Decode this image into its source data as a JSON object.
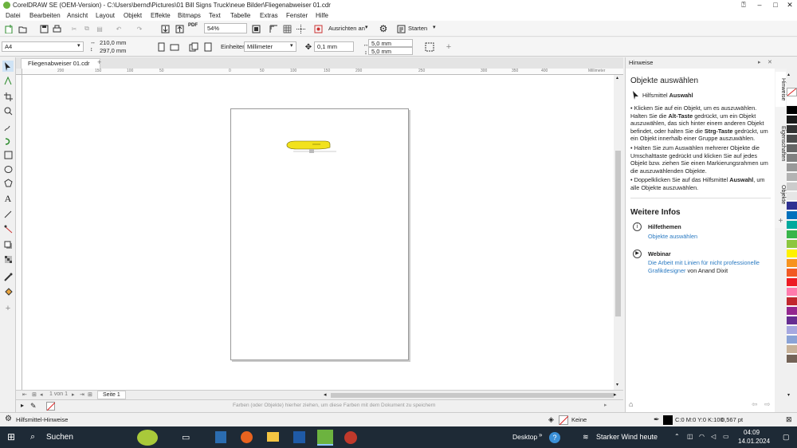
{
  "window": {
    "title": "CorelDRAW SE (OEM-Version) - C:\\Users\\bernd\\Pictures\\01 Bill Signs Truck\\neue Bilder\\Fliegenabweiser 01.cdr",
    "minimize": "–",
    "maximize": "□",
    "close": "✕",
    "help": "?"
  },
  "menu": [
    "Datei",
    "Bearbeiten",
    "Ansicht",
    "Layout",
    "Objekt",
    "Effekte",
    "Bitmaps",
    "Text",
    "Tabelle",
    "Extras",
    "Fenster",
    "Hilfe"
  ],
  "standard_toolbar": {
    "zoom": "54%",
    "snap_label": "Ausrichten an",
    "launch_label": "Starten",
    "pdf_label": "PDF"
  },
  "property_bar": {
    "page_size": "A4",
    "width": "210,0 mm",
    "height": "297,0 mm",
    "units_label": "Einheiten:",
    "units_value": "Millimeter",
    "nudge": "0,1 mm",
    "dup_x": "5,0 mm",
    "dup_y": "5,0 mm"
  },
  "document": {
    "tab_label": "Fliegenabweiser 01.cdr",
    "ruler_h": [
      "200",
      "150",
      "100",
      "50",
      "0",
      "50",
      "100",
      "150",
      "200",
      "250",
      "300",
      "350",
      "400"
    ],
    "ruler_unit": "Millimeter",
    "page_nav": "1 von 1",
    "page_tab": "Seite 1",
    "palette_hint": "Farben (oder Objekte) hierher ziehen, um diese Farben mit dem Dokument zu speichern"
  },
  "hints": {
    "panel_title": "Hinweise",
    "heading": "Objekte auswählen",
    "tool_prefix": "Hilfsmittel",
    "tool_name": "Auswahl",
    "b1_a": "Klicken Sie auf ein Objekt, um es auszuwählen. Halten Sie die",
    "b1_key1": "Alt-Taste",
    "b1_b": "gedrückt, um ein Objekt auszuwählen, das sich hinter einem anderen Objekt befindet, oder halten Sie die",
    "b1_key2": "Strg-Taste",
    "b1_c": "gedrückt, um ein Objekt innerhalb einer Gruppe auszuwählen.",
    "b2": "Halten Sie zum Auswählen mehrerer Objekte die Umschalttaste gedrückt und klicken Sie auf jedes Objekt bzw. ziehen Sie einen Markierungsrahmen um die auszuwählenden Objekte.",
    "b3_a": "Doppelklicken Sie auf das Hilfsmittel",
    "b3_key": "Auswahl",
    "b3_b": ", um alle Objekte auszuwählen.",
    "more_title": "Weitere Infos",
    "topics_title": "Hilfethemen",
    "topics_link": "Objekte auswählen",
    "webinar_title": "Webinar",
    "webinar_link": "Die Arbeit mit Linien für nicht professionelle Grafikdesigner",
    "webinar_suffix": "von Anand Dixit"
  },
  "side_tabs": [
    "Hinweise",
    "Eigenschaften",
    "Objekte"
  ],
  "palette_colors": [
    "#ffffff",
    "#000000",
    "#1a1a1a",
    "#333333",
    "#4d4d4d",
    "#666666",
    "#808080",
    "#999999",
    "#b3b3b3",
    "#cccccc",
    "#e6e6e6",
    "#2e3192",
    "#0071bc",
    "#00a99d",
    "#39b54a",
    "#8cc63f",
    "#fff200",
    "#f7931e",
    "#f15a24",
    "#ed1c24",
    "#ff7bac",
    "#c1272d",
    "#93278f",
    "#662d91",
    "#a6a8e0",
    "#8aa3d6",
    "#c7b299",
    "#736357"
  ],
  "status": {
    "left": "Hilfsmittel-Hinweise",
    "fill": "Keine",
    "outline": "C:0 M:0 Y:0 K:100",
    "outline_width": "0,567 pt"
  },
  "taskbar": {
    "search": "Suchen",
    "desktop": "Desktop",
    "weather": "Starker Wind heute",
    "time": "04:09",
    "date": "14.01.2024"
  }
}
